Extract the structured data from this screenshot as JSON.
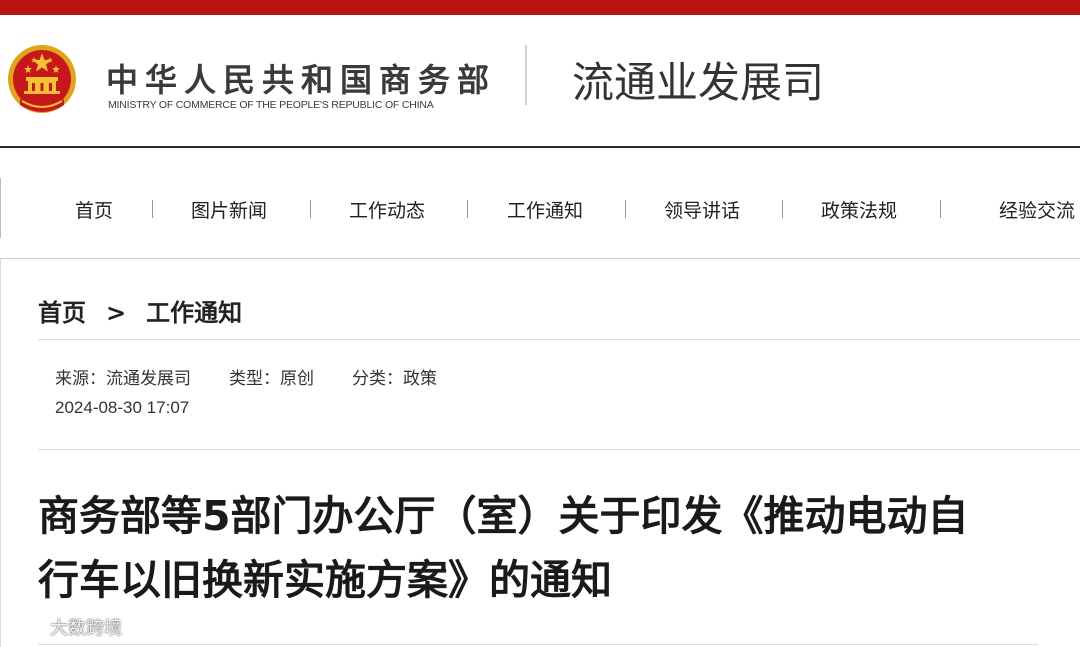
{
  "header": {
    "ministry_cn": "中华人民共和国商务部",
    "ministry_en": "MINISTRY OF COMMERCE OF THE PEOPLE'S REPUBLIC OF CHINA",
    "department": "流通业发展司"
  },
  "nav": {
    "items": [
      {
        "label": "首页"
      },
      {
        "label": "图片新闻"
      },
      {
        "label": "工作动态"
      },
      {
        "label": "工作通知"
      },
      {
        "label": "领导讲话"
      },
      {
        "label": "政策法规"
      },
      {
        "label": "经验交流"
      }
    ]
  },
  "breadcrumb": {
    "home": "首页",
    "separator": ">",
    "current": "工作通知"
  },
  "article": {
    "source": "来源：流通发展司",
    "type": "类型：原创",
    "category": "分类：政策",
    "datetime": "2024-08-30 17:07",
    "title_line1": "商务部等5部门办公厅（室）关于印发《推动电动自",
    "title_line2": "行车以旧换新实施方案》的通知"
  },
  "watermark": {
    "text": "大数跨境"
  },
  "colors": {
    "top_bar": "#b81212",
    "emblem_red": "#c8161d",
    "emblem_gold": "#f2c230"
  },
  "icons": {
    "emblem": "national-emblem-icon",
    "watermark_logo": "chat-bubble-logo-icon"
  }
}
